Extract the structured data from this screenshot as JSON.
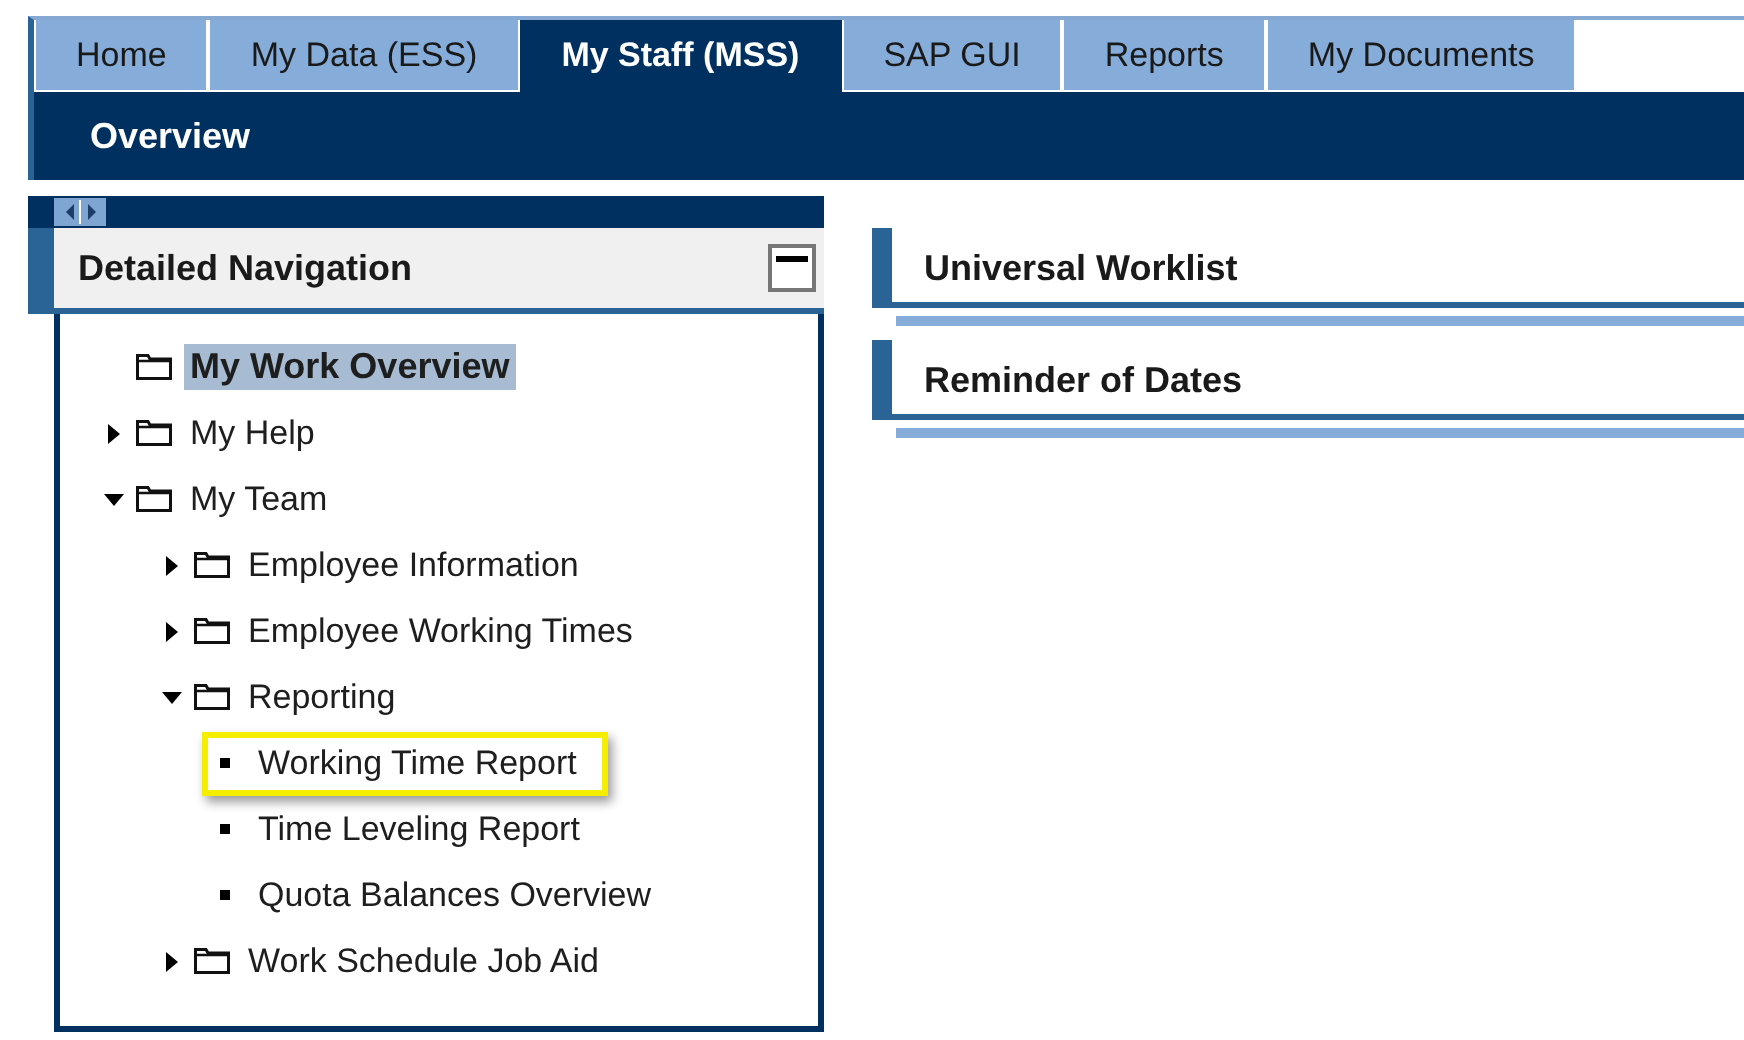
{
  "tabs": [
    {
      "label": "Home",
      "selected": false
    },
    {
      "label": "My Data (ESS)",
      "selected": false
    },
    {
      "label": "My Staff (MSS)",
      "selected": true
    },
    {
      "label": "SAP GUI",
      "selected": false
    },
    {
      "label": "Reports",
      "selected": false
    },
    {
      "label": "My Documents",
      "selected": false
    }
  ],
  "subnav": {
    "label": "Overview"
  },
  "navigation": {
    "title": "Detailed Navigation",
    "items": [
      {
        "label": "My Work Overview",
        "kind": "entry",
        "selected": true,
        "highlighted": false
      },
      {
        "label": "My Help",
        "kind": "folder",
        "expanded": false,
        "selected": false,
        "highlighted": false
      },
      {
        "label": "My Team",
        "kind": "folder",
        "expanded": true,
        "selected": false,
        "highlighted": false,
        "children": [
          {
            "label": "Employee Information",
            "kind": "folder",
            "expanded": false,
            "selected": false,
            "highlighted": false
          },
          {
            "label": "Employee Working Times",
            "kind": "folder",
            "expanded": false,
            "selected": false,
            "highlighted": false
          },
          {
            "label": "Reporting",
            "kind": "folder",
            "expanded": true,
            "selected": false,
            "highlighted": false,
            "children": [
              {
                "label": "Working Time Report",
                "kind": "leaf",
                "selected": false,
                "highlighted": true
              },
              {
                "label": "Time Leveling Report",
                "kind": "leaf",
                "selected": false,
                "highlighted": false
              },
              {
                "label": "Quota Balances Overview",
                "kind": "leaf",
                "selected": false,
                "highlighted": false
              }
            ]
          },
          {
            "label": "Work Schedule Job Aid",
            "kind": "folder",
            "expanded": false,
            "selected": false,
            "highlighted": false
          }
        ]
      }
    ]
  },
  "sections": [
    {
      "title": "Universal Worklist"
    },
    {
      "title": "Reminder of Dates"
    }
  ]
}
